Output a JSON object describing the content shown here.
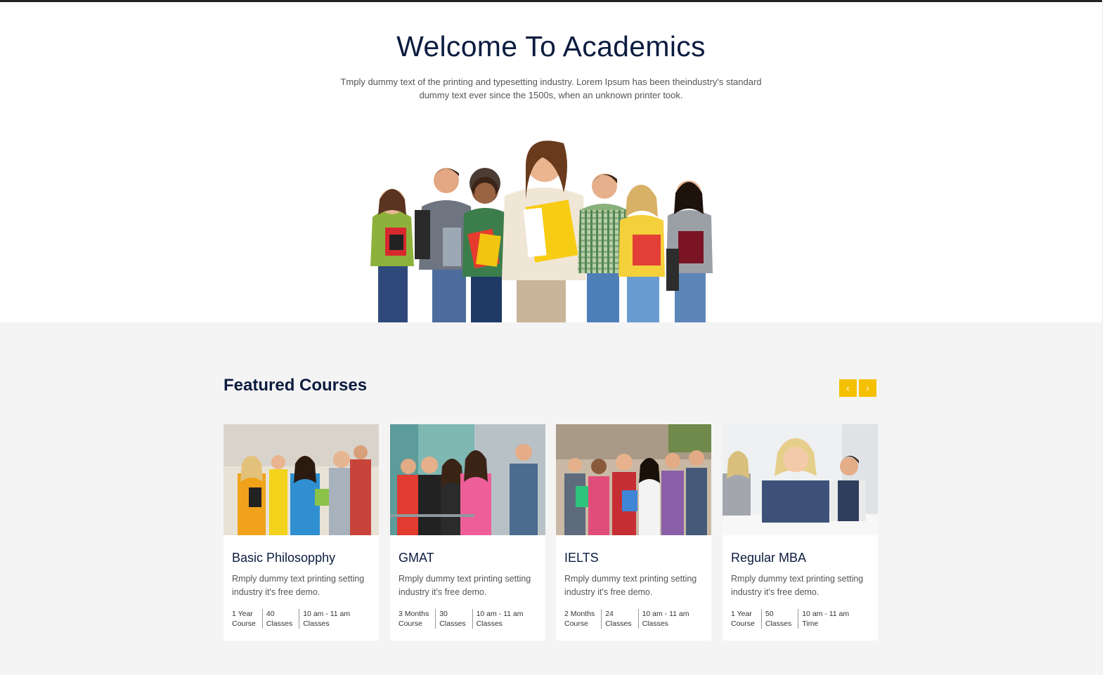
{
  "welcome": {
    "title": "Welcome To Academics",
    "description": "Tmply dummy text of the printing and typesetting industry. Lorem Ipsum has been theindustry's standard dummy text ever since the 1500s, when an unknown printer took."
  },
  "featured": {
    "title": "Featured Courses",
    "prev_label": "‹",
    "next_label": "›",
    "courses": [
      {
        "title": "Basic Philosopphy",
        "description": "Rmply dummy text printing setting industry it's free demo.",
        "meta": [
          {
            "value": "1 Year",
            "label": "Course"
          },
          {
            "value": "40",
            "label": "Classes"
          },
          {
            "value": "10 am - 11 am",
            "label": "Classes"
          }
        ]
      },
      {
        "title": "GMAT",
        "description": "Rmply dummy text printing setting industry it's free demo.",
        "meta": [
          {
            "value": "3 Months",
            "label": "Course"
          },
          {
            "value": "30",
            "label": "Classes"
          },
          {
            "value": "10 am - 11 am",
            "label": "Classes"
          }
        ]
      },
      {
        "title": "IELTS",
        "description": "Rmply dummy text printing setting industry it's free demo.",
        "meta": [
          {
            "value": "2 Months",
            "label": "Course"
          },
          {
            "value": "24",
            "label": "Classes"
          },
          {
            "value": "10 am - 11 am",
            "label": "Classes"
          }
        ]
      },
      {
        "title": "Regular MBA",
        "description": "Rmply dummy text printing setting industry it's free demo.",
        "meta": [
          {
            "value": "1 Year",
            "label": "Course"
          },
          {
            "value": "50",
            "label": "Classes"
          },
          {
            "value": "10 am - 11 am",
            "label": "Time"
          }
        ]
      }
    ]
  },
  "colors": {
    "heading": "#0c1c3f",
    "accent": "#f5c000",
    "section_bg": "#f4f4f4"
  }
}
